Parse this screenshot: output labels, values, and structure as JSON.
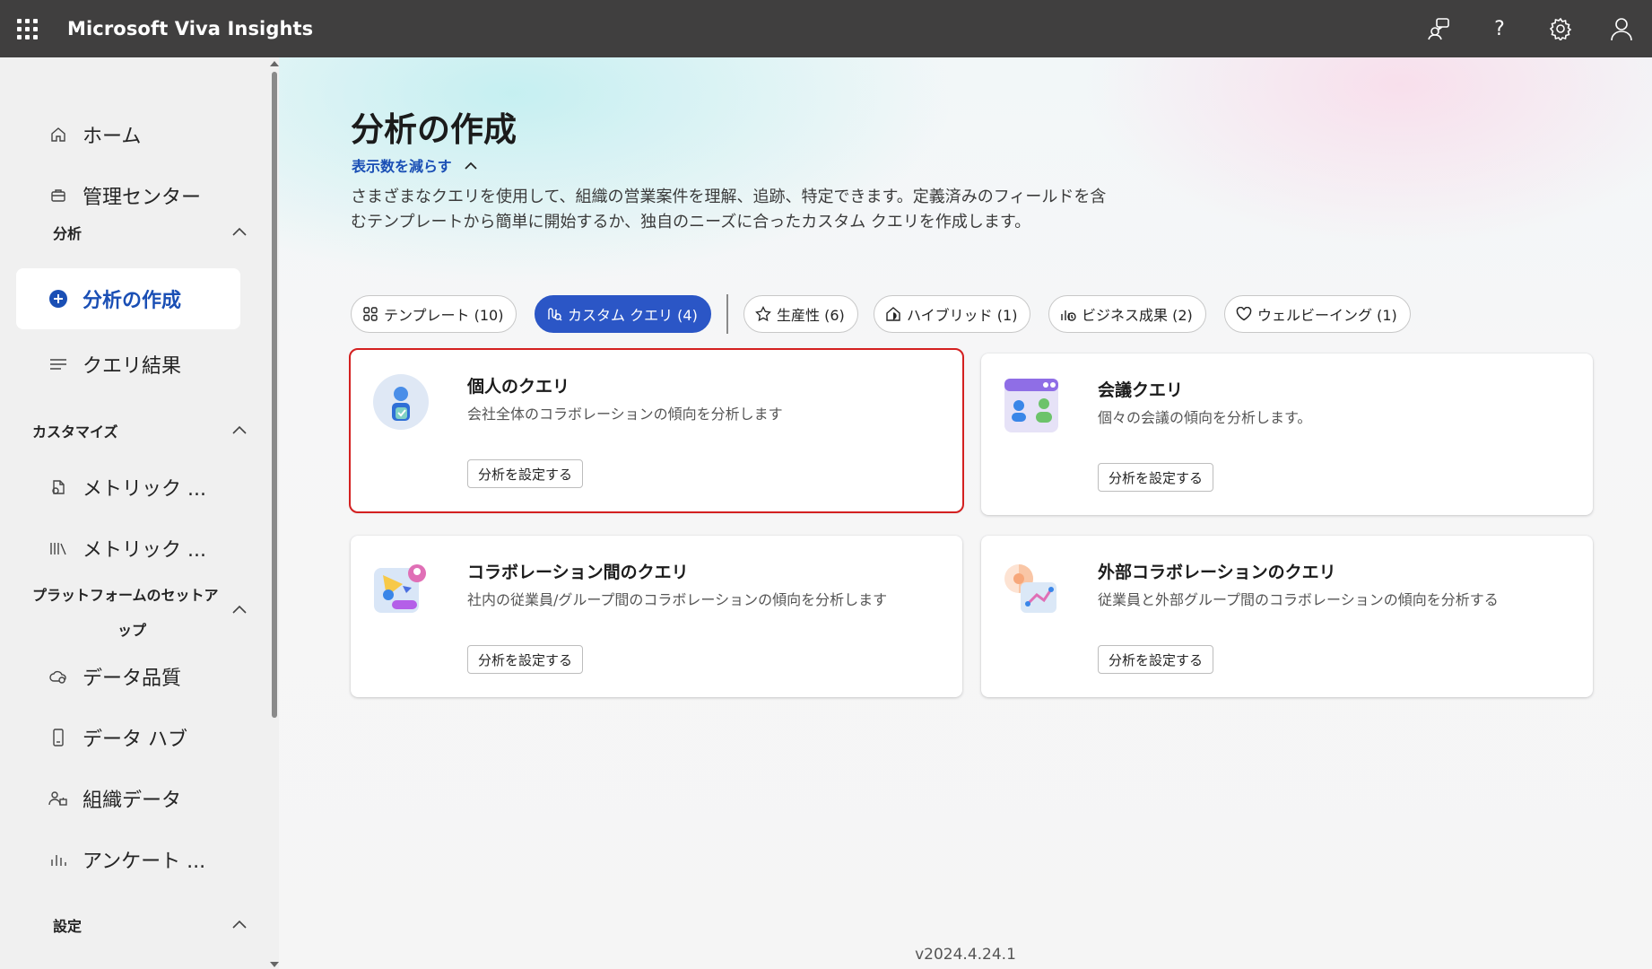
{
  "app": {
    "title": "Microsoft Viva Insights"
  },
  "topbar": {
    "icons": [
      "feedback-icon",
      "help-icon",
      "settings-icon",
      "account-icon"
    ],
    "help_glyph": "?"
  },
  "sidebar": {
    "items": [
      {
        "label": "ホーム",
        "icon": "home-icon"
      },
      {
        "label": "管理センター",
        "icon": "briefcase-icon"
      }
    ],
    "sections": {
      "analysis": {
        "title": "分析",
        "items": [
          {
            "label": "分析の作成",
            "icon": "add-circle-icon",
            "selected": true
          },
          {
            "label": "クエリ結果",
            "icon": "list-icon"
          }
        ]
      },
      "customize": {
        "title": "カスタマイズ",
        "items": [
          {
            "label": "メトリック ...",
            "icon": "metric-icon"
          },
          {
            "label": "メトリック ...",
            "icon": "library-icon"
          }
        ]
      },
      "platform": {
        "title_line1": "プラットフォームのセットア",
        "title_line2": "ップ",
        "items": [
          {
            "label": "データ品質",
            "icon": "data-quality-icon"
          },
          {
            "label": "データ ハブ",
            "icon": "data-hub-icon"
          },
          {
            "label": "組織データ",
            "icon": "org-data-icon"
          },
          {
            "label": "アンケート ...",
            "icon": "survey-icon"
          }
        ]
      },
      "settings": {
        "title": "設定"
      }
    }
  },
  "main": {
    "title": "分析の作成",
    "collapse_link": "表示数を減らす",
    "description": "さまざまなクエリを使用して、組織の営業案件を理解、追跡、特定できます。定義済みのフィールドを含むテンプレートから簡単に開始するか、独自のニーズに合ったカスタム クエリを作成します。",
    "filters": [
      {
        "label": "テンプレート (10)",
        "icon": "grid-icon",
        "active": false
      },
      {
        "label": "カスタム クエリ (4)",
        "icon": "custom-query-icon",
        "active": true
      },
      {
        "label": "生産性 (6)",
        "icon": "star-icon",
        "active": false
      },
      {
        "label": "ハイブリッド (1)",
        "icon": "hybrid-icon",
        "active": false
      },
      {
        "label": "ビジネス成果 (2)",
        "icon": "business-icon",
        "active": false
      },
      {
        "label": "ウェルビーイング (1)",
        "icon": "heart-icon",
        "active": false
      }
    ],
    "cards": [
      {
        "title": "個人のクエリ",
        "description": "会社全体のコラボレーションの傾向を分析します",
        "button": "分析を設定する",
        "icon": "person-query-icon",
        "highlighted": true
      },
      {
        "title": "会議クエリ",
        "description": "個々の会議の傾向を分析します。",
        "button": "分析を設定する",
        "icon": "meeting-query-icon",
        "highlighted": false
      },
      {
        "title": "コラボレーション間のクエリ",
        "description": "社内の従業員/グループ間のコラボレーションの傾向を分析します",
        "button": "分析を設定する",
        "icon": "cross-collab-query-icon",
        "highlighted": false
      },
      {
        "title": "外部コラボレーションのクエリ",
        "description": "従業員と外部グループ間のコラボレーションの傾向を分析する",
        "button": "分析を設定する",
        "icon": "external-collab-query-icon",
        "highlighted": false
      }
    ],
    "version": "v2024.4.24.1"
  },
  "colors": {
    "accent": "#2b56c6",
    "link": "#1a4fb5",
    "topbar": "#403f3f",
    "highlight": "#d42020"
  }
}
